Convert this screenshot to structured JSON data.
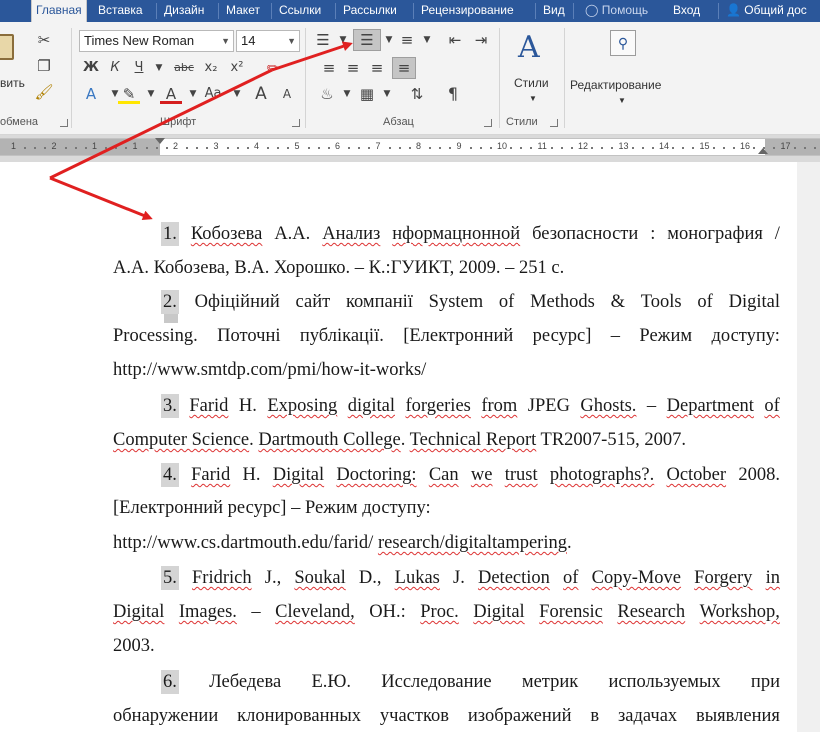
{
  "tabs": [
    "Главная",
    "Вставка",
    "Дизайн",
    "Макет",
    "Ссылки",
    "Рассылки",
    "Рецензирование",
    "Вид"
  ],
  "help": {
    "label": "Помощь"
  },
  "signin": {
    "label": "Вход"
  },
  "share": {
    "label": "Общий дос"
  },
  "ribbon": {
    "clipboard": {
      "paste_label": "вить",
      "group_label": "обмена"
    },
    "font": {
      "font_name": "Times New Roman",
      "font_size": "14",
      "bold": "Ж",
      "italic": "К",
      "underline": "Ч",
      "strike": "abc",
      "subscript": "x₂",
      "superscript": "x²",
      "case_btn": "Aa",
      "grow_btn": "A",
      "shrink_btn": "A",
      "group_label": "Шрифт"
    },
    "paragraph": {
      "group_label": "Абзац",
      "pilcrow": "¶"
    },
    "styles": {
      "styles_label": "Стили",
      "group_label": "Стили"
    },
    "editing": {
      "label": "Редактирование"
    }
  },
  "ruler": {
    "numbers": [
      "1",
      "2",
      "1",
      "1",
      "2",
      "3",
      "4",
      "5",
      "6",
      "7",
      "8",
      "9",
      "10",
      "11",
      "12",
      "13",
      "14",
      "15",
      "16",
      "17"
    ]
  },
  "document": {
    "entries": [
      {
        "num": "1.",
        "lines": [
          "Кобозева А.А. Анализ нформацнонной безопасности : монография /",
          "А.А. Кобозева, В.А. Хорошко. – К.:ГУИКТ, 2009. – 251 с."
        ]
      },
      {
        "num": "2.",
        "lines": [
          "Офіційний сайт компанії System of Methods & Tools of Digital",
          "Processing. Поточні публікації. [Електронний ресурс] – Режим доступу:",
          "http://www.smtdp.com/pmi/how-it-works/"
        ]
      },
      {
        "num": "3.",
        "lines": [
          "Farid H. Exposing digital forgeries from JPEG Ghosts. – Department of",
          "Computer Science. Dartmouth College. Technical Report TR2007-515, 2007."
        ]
      },
      {
        "num": "4.",
        "lines": [
          "Farid H. Digital Doctoring: Can we trust photographs?. October 2008.",
          "[Електронний ресурс] – Режим доступу:",
          "http://www.cs.dartmouth.edu/farid/ research/digitaltampering."
        ]
      },
      {
        "num": "5.",
        "lines": [
          "Fridrich J., Soukal D., Lukas J. Detection of Copy-Move Forgery in",
          "Digital Images. – Cleveland, OH.: Proc. Digital Forensic Research Workshop,",
          "2003."
        ]
      },
      {
        "num": "6.",
        "lines": [
          "Лебедева Е.Ю. Исследование метрик используемых при",
          "обнаружении клонированных участков изображений в задачах выявления"
        ]
      }
    ]
  },
  "annotation": {
    "arrow_color": "#e02020"
  }
}
